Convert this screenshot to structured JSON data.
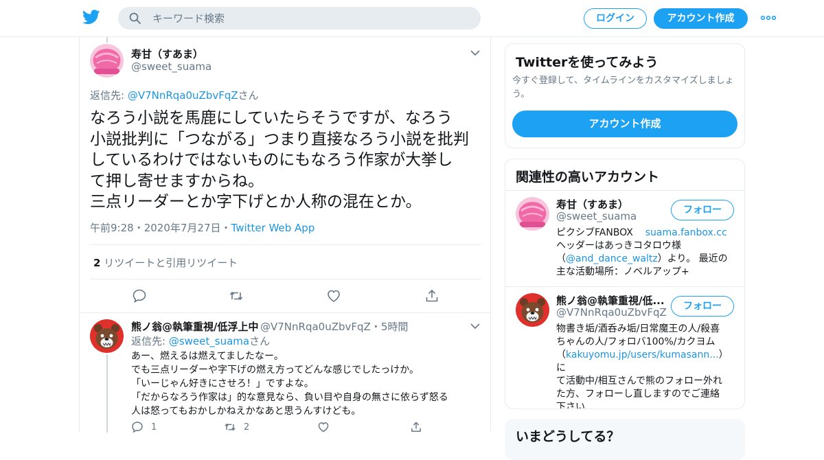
{
  "header": {
    "logo_icon": "twitter-bird-icon",
    "search_placeholder": "キーワード検索",
    "login_label": "ログイン",
    "signup_label": "アカウント作成",
    "more_icon": "more-dots-icon"
  },
  "colors": {
    "accent": "#1da1f2",
    "link": "#1b95e0",
    "muted": "#657786",
    "border": "#e6ecf0"
  },
  "tweet": {
    "name": "寿甘（すあま）",
    "handle": "@sweet_suama",
    "reply_prefix": "返信先: ",
    "reply_handle": "@V7NnRqa0uZbvFqZ",
    "reply_suffix": "さん",
    "text": "なろう小説を馬鹿にしていたらそうですが、なろう\n小説批判に「つながる」つまり直接なろう小説を批判\nしているわけではないものにもなろう作家が大挙し\nて押し寄せますからね。\n三点リーダーとか字下げとか人称の混在とか。",
    "time": "午前9:28",
    "date": "2020年7月27日",
    "dot": "・",
    "source": "Twitter Web App",
    "retweet_count": "2",
    "retweet_label": " リツイートと引用リツイート"
  },
  "reply": {
    "name": "熊ノ翁@執筆重視/低浮上中",
    "handle": "@V7NnRqa0uZbvFqZ",
    "dot": "・",
    "age": "5時間",
    "reply_prefix": "返信先: ",
    "reply_handle": "@sweet_suama",
    "reply_suffix": "さん",
    "text": "あー、燃えるは燃えてましたなー。\nでも三点リーダーや字下げの燃え方ってどんな感じでしたっけか。\n「いーじゃん好きにさせろ！」ですよな。\n「だからなろう作家は」的な意見なら、負い目や自身の無さに依らず怒る\n人は怒ってもおかしかねえかなあと思うんすけども。",
    "reply_count": "1",
    "retweet_count": "2"
  },
  "signup_card": {
    "title": "Twitterを使ってみよう",
    "subtitle": "今すぐ登録して、タイムラインをカスタマイズしましょう。",
    "button_label": "アカウント作成"
  },
  "related": {
    "title": "関連性の高いアカウント",
    "follow_label": "フォロー",
    "accounts": [
      {
        "name": "寿甘（すあま）",
        "handle": "@sweet_suama",
        "bio_1": "ピクシブFANBOX",
        "bio_link_1": "suama.fanbox.cc",
        "bio_2": "ヘッダーはあっきコタロウ様",
        "bio_3a": "（",
        "bio_link_2": "@and_dance_waltz",
        "bio_3b": "）より。 最近の",
        "bio_4": "主な活動場所：ノベルアップ+"
      },
      {
        "name": "熊ノ翁@執筆重視/低...",
        "handle": "@V7NnRqa0uZbvFqZ",
        "bio_1": "物書き垢/酒呑み垢/日常魔王の人/殺喜",
        "bio_2": "ちゃんの人/フォロバ100%/カクヨム",
        "bio_3a": "（",
        "bio_link_1": "kakuyomu.jp/users/kumasann...",
        "bio_3b": "）に",
        "bio_4": "て活動中/相互さんで熊のフォロー外れ",
        "bio_5": "た方、フォローし直しますのでご連絡",
        "bio_6": "下さい"
      }
    ]
  },
  "next_card": {
    "title": "いまどうしてる？"
  }
}
